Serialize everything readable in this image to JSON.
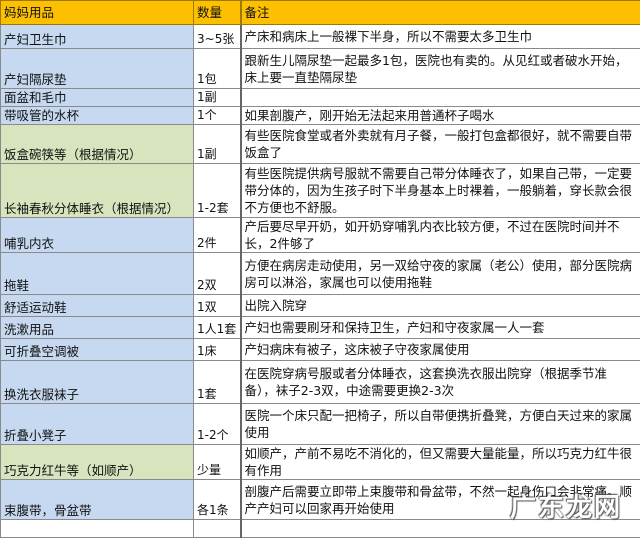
{
  "headers": {
    "item": "妈妈用品",
    "qty": "数量",
    "note": "备注"
  },
  "rows": [
    {
      "item": "产妇卫生巾",
      "qty": "3~5张",
      "note": "产床和病床上一般裸下半身，所以不需要太多卫生巾",
      "color": "blue"
    },
    {
      "item": "产妇隔尿垫",
      "qty": "1包",
      "note": "跟新生儿隔尿垫一起最多1包，医院也有卖的。从见红或者破水开始，床上要一直垫隔尿垫",
      "color": "blue"
    },
    {
      "item": "面盆和毛巾",
      "qty": "1副",
      "note": "",
      "color": "blue"
    },
    {
      "item": "带吸管的水杯",
      "qty": "1个",
      "note": "如果剖腹产，刚开始无法起来用普通杯子喝水",
      "color": "blue"
    },
    {
      "item": "饭盒碗筷等（根据情况）",
      "qty": "1副",
      "note": "有些医院食堂或者外卖就有月子餐，一般打包盒都很好，就不需要自带饭盒了",
      "color": "green"
    },
    {
      "item": "长袖春秋分体睡衣（根据情况）",
      "qty": "1-2套",
      "note": "有些医院提供病号服就不需要自己带分体睡衣了，如果自己带，一定要带分体的，因为生孩子时下半身基本上时裸着，一般躺着，穿长款会很不方便也不舒服。",
      "color": "green"
    },
    {
      "item": "哺乳内衣",
      "qty": "2件",
      "note": "产后要尽早开奶，如开奶穿哺乳内衣比较方便，不过在医院时间并不长，2件够了",
      "color": "blue"
    },
    {
      "item": "拖鞋",
      "qty": "2双",
      "note": "方便在病房走动使用，另一双给守夜的家属（老公）使用，部分医院病房可以淋浴，家属也可以使用拖鞋",
      "color": "blue"
    },
    {
      "item": "舒适运动鞋",
      "qty": "1双",
      "note": "出院入院穿",
      "color": "blue"
    },
    {
      "item": "洗漱用品",
      "qty": "1人1套",
      "note": "产妇也需要刷牙和保持卫生，产妇和守夜家属一人一套",
      "color": "blue"
    },
    {
      "item": "可折叠空调被",
      "qty": "1床",
      "note": "产妇病床有被子，这床被子守夜家属使用",
      "color": "blue"
    },
    {
      "item": "换洗衣服袜子",
      "qty": "1套",
      "note": "在医院穿病号服或者分体睡衣，这套换洗衣服出院穿（根据季节准备），袜子2-3双，中途需要更换2-3次",
      "color": "blue"
    },
    {
      "item": "折叠小凳子",
      "qty": "1-2个",
      "note": "医院一个床只配一把椅子，所以自带便携折叠凳，方便白天过来的家属使用",
      "color": "blue"
    },
    {
      "item": "巧克力红牛等（如顺产）",
      "qty": "少量",
      "note": "如顺产，产前不易吃不消化的，但又需要大量能量，所以巧克力红牛很有作用",
      "color": "green"
    },
    {
      "item": "束腹带，骨盆带",
      "qty": "各1条",
      "note": "剖腹产后需要立即带上束腹带和骨盆带，不然一起身伤口会非常痛。顺产产妇可以回家再开始使用",
      "color": "blue"
    }
  ],
  "watermark": "广东龙网"
}
